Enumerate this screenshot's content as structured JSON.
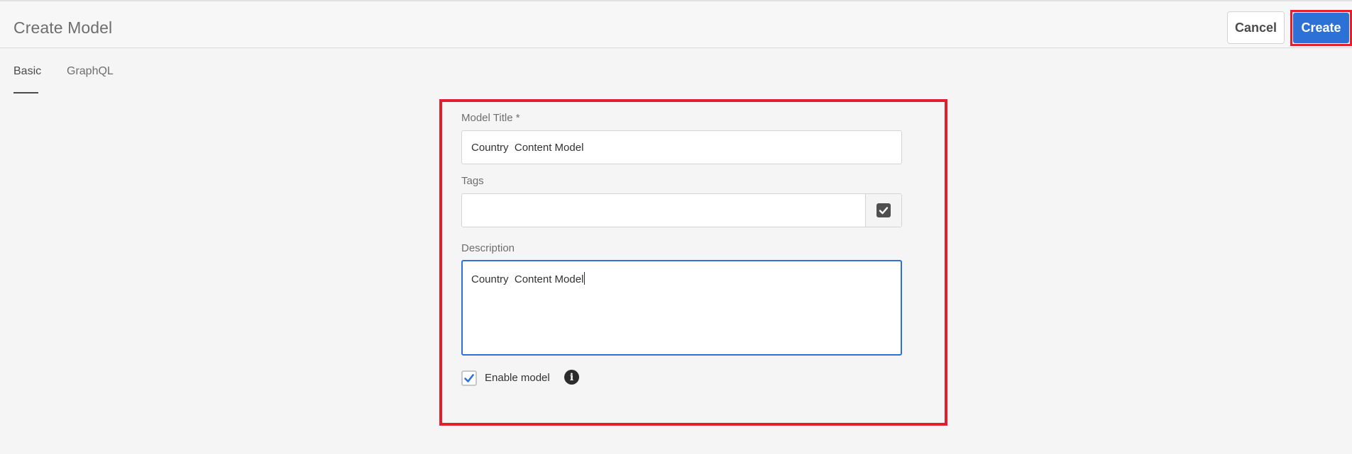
{
  "header": {
    "title": "Create Model",
    "cancel_label": "Cancel",
    "create_label": "Create"
  },
  "tabs": [
    {
      "label": "Basic",
      "active": true
    },
    {
      "label": "GraphQL",
      "active": false
    }
  ],
  "form": {
    "model_title": {
      "label": "Model Title *",
      "value": "Country  Content Model"
    },
    "tags": {
      "label": "Tags",
      "value": "",
      "button_icon": "checkbox-checked-icon"
    },
    "description": {
      "label": "Description",
      "value": "Country  Content Model"
    },
    "enable_model": {
      "label": "Enable model",
      "checked": true,
      "info_icon": "info-icon"
    }
  },
  "colors": {
    "accent": "#2d70d6",
    "highlight": "#e1202e",
    "background": "#f5f5f5"
  }
}
